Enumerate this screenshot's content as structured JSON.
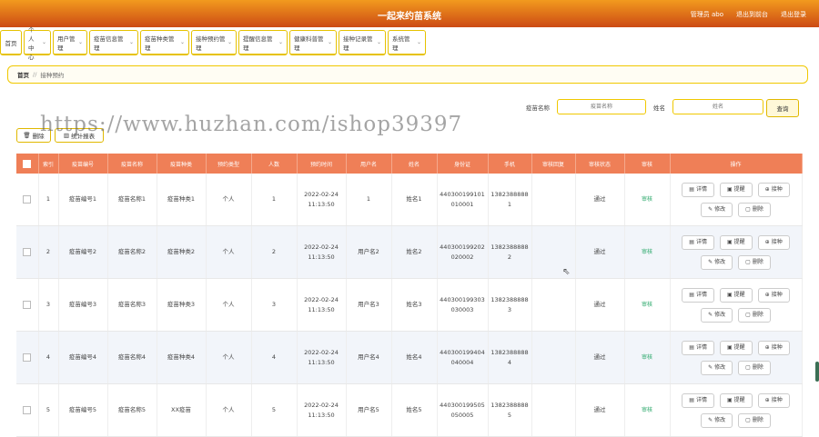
{
  "header": {
    "title": "一起来约苗系统",
    "user": "管理员 abo",
    "back": "退出到前台",
    "logout": "退出登录"
  },
  "nav": {
    "items": [
      {
        "label": "首页",
        "dropdown": false
      },
      {
        "label": "个人中心",
        "dropdown": true
      },
      {
        "label": "用户管理",
        "dropdown": true
      },
      {
        "label": "疫苗信息管理",
        "dropdown": true
      },
      {
        "label": "疫苗种类管理",
        "dropdown": true
      },
      {
        "label": "接种预约管理",
        "dropdown": true
      },
      {
        "label": "提醒信息管理",
        "dropdown": true
      },
      {
        "label": "健康科普管理",
        "dropdown": true
      },
      {
        "label": "接种记录管理",
        "dropdown": true
      },
      {
        "label": "系统管理",
        "dropdown": true
      }
    ]
  },
  "breadcrumb": {
    "home": "首页",
    "separator": "//",
    "current": "接种预约"
  },
  "search": {
    "vaccine_label": "疫苗名称",
    "vaccine_placeholder": "疫苗名称",
    "name_label": "姓名",
    "name_placeholder": "姓名",
    "button": "查询"
  },
  "toolbar": {
    "delete": "删除",
    "report": "统计报表"
  },
  "watermark": "https://www.huzhan.com/ishop39397",
  "table": {
    "columns": [
      "索引",
      "疫苗编号",
      "疫苗名称",
      "疫苗种类",
      "预约类型",
      "人数",
      "预约时间",
      "用户名",
      "姓名",
      "身份证",
      "手机",
      "审核回复",
      "审核状态",
      "审核",
      "操作"
    ],
    "rows": [
      {
        "index": "1",
        "code": "疫苗编号1",
        "name": "疫苗名称1",
        "type": "疫苗种类1",
        "booking": "个人",
        "count": "1",
        "time": "2022-02-24 11:13:50",
        "user": "1",
        "person": "姓名1",
        "idcard": "440300199101010001",
        "phone": "13823888881",
        "reply": "",
        "status": "通过",
        "review": "审核"
      },
      {
        "index": "2",
        "code": "疫苗编号2",
        "name": "疫苗名称2",
        "type": "疫苗种类2",
        "booking": "个人",
        "count": "2",
        "time": "2022-02-24 11:13:50",
        "user": "用户名2",
        "person": "姓名2",
        "idcard": "440300199202020002",
        "phone": "13823888882",
        "reply": "",
        "status": "通过",
        "review": "审核"
      },
      {
        "index": "3",
        "code": "疫苗编号3",
        "name": "疫苗名称3",
        "type": "疫苗种类3",
        "booking": "个人",
        "count": "3",
        "time": "2022-02-24 11:13:50",
        "user": "用户名3",
        "person": "姓名3",
        "idcard": "440300199303030003",
        "phone": "13823888883",
        "reply": "",
        "status": "通过",
        "review": "审核"
      },
      {
        "index": "4",
        "code": "疫苗编号4",
        "name": "疫苗名称4",
        "type": "疫苗种类4",
        "booking": "个人",
        "count": "4",
        "time": "2022-02-24 11:13:50",
        "user": "用户名4",
        "person": "姓名4",
        "idcard": "440300199404040004",
        "phone": "13823888884",
        "reply": "",
        "status": "通过",
        "review": "审核"
      },
      {
        "index": "5",
        "code": "疫苗编号5",
        "name": "疫苗名称5",
        "type": "XX疫苗",
        "booking": "个人",
        "count": "5",
        "time": "2022-02-24 11:13:50",
        "user": "用户名5",
        "person": "姓名5",
        "idcard": "440300199505050005",
        "phone": "13823888885",
        "reply": "",
        "status": "通过",
        "review": "审核"
      }
    ],
    "actions": [
      "详情",
      "提醒",
      "接种",
      "修改",
      "删除"
    ]
  },
  "colors": {
    "header_top": "#f29a1e",
    "header_bottom": "#cc4a14",
    "table_header": "#ef7f57",
    "accent_border": "#f0c800"
  }
}
